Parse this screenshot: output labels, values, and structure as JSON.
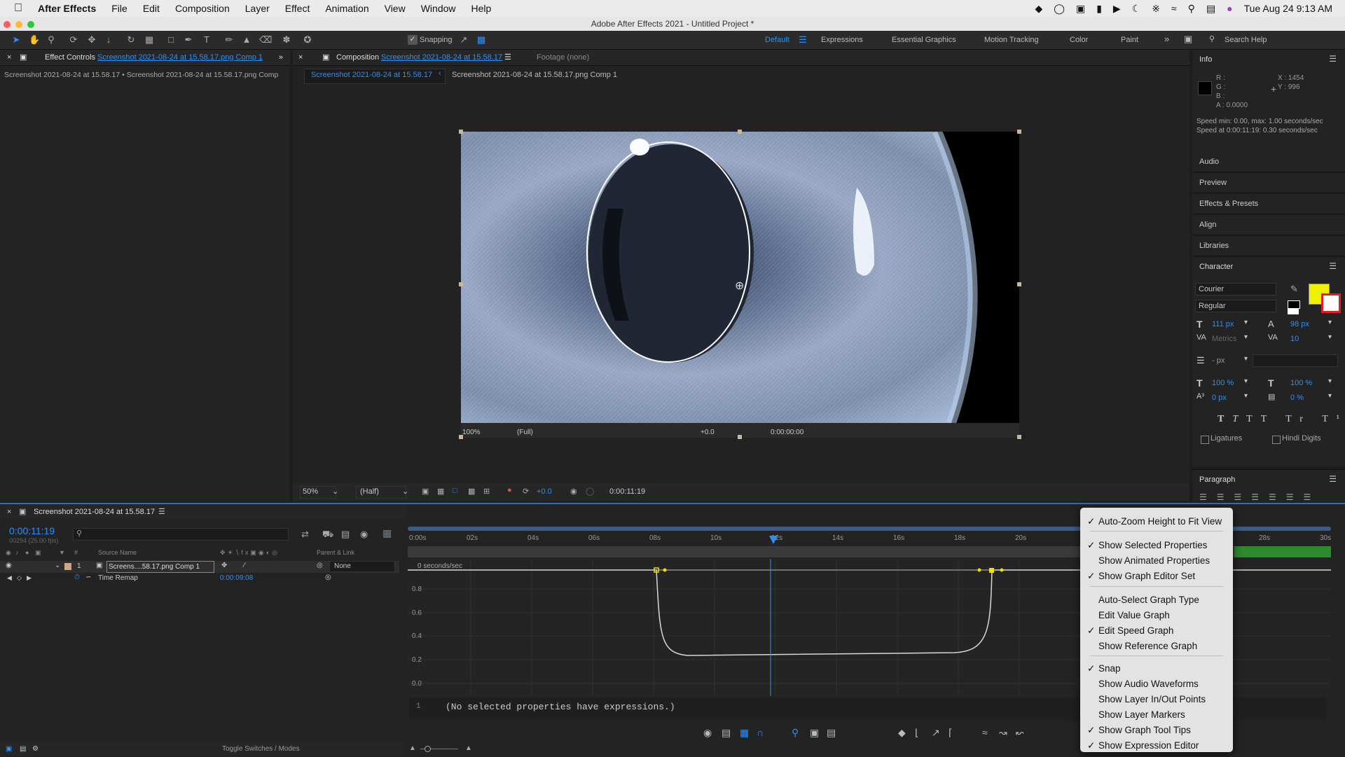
{
  "menubar": {
    "app": "After Effects",
    "items": [
      "File",
      "Edit",
      "Composition",
      "Layer",
      "Effect",
      "Animation",
      "View",
      "Window",
      "Help"
    ],
    "datetime": "Tue Aug 24  9:13 AM"
  },
  "window_title": "Adobe After Effects 2021 - Untitled Project *",
  "toolbar": {
    "snapping_label": "Snapping",
    "workspaces": [
      "Default",
      "Expressions",
      "Essential Graphics",
      "Motion Tracking",
      "Color",
      "Paint"
    ],
    "search_placeholder": "Search Help"
  },
  "effect_controls": {
    "label": "Effect Controls",
    "name": "Screenshot 2021-08-24 at 15.58.17.png Comp 1",
    "subtitle": "Screenshot 2021-08-24 at 15.58.17 • Screenshot 2021-08-24 at 15.58.17.png Comp"
  },
  "composition": {
    "label": "Composition",
    "name": "Screenshot 2021-08-24 at 15.58.17",
    "footage": "Footage (none)",
    "crumb_active": "Screenshot 2021-08-24 at 15.58.17",
    "crumb_other": "Screenshot 2021-08-24 at 15.58.17.png Comp 1",
    "zoom": "50%",
    "resolution": "(Half)",
    "exposure": "+0.0",
    "timecode": "0:00:11:19",
    "inner_zoom": "100%",
    "inner_res": "(Full)",
    "inner_exposure": "+0.0",
    "inner_timecode": "0:00:00:00"
  },
  "info": {
    "title": "Info",
    "r": "R :",
    "g": "G :",
    "b": "B :",
    "a": "A : 0.0000",
    "x": "X : 1454",
    "y": "Y : 996",
    "speed1": "Speed min: 0.00, max: 1.00 seconds/sec",
    "speed2": "Speed at 0:00:11:19: 0.30 seconds/sec"
  },
  "right_panels": [
    "Audio",
    "Preview",
    "Effects & Presets",
    "Align",
    "Libraries"
  ],
  "character": {
    "title": "Character",
    "font": "Courier",
    "style": "Regular",
    "size": "111 px",
    "leading": "98 px",
    "kerning": "Metrics",
    "tracking": "10",
    "stroke": "- px",
    "vscale": "100 %",
    "hscale": "100 %",
    "baseline": "0 px",
    "tsume": "0 %",
    "ligatures": "Ligatures",
    "hindi": "Hindi Digits",
    "fill_color": "#f0f000"
  },
  "paragraph": {
    "title": "Paragraph"
  },
  "timeline": {
    "tab": "Screenshot 2021-08-24 at 15.58.17",
    "timecode": "0:00:11:19",
    "frames": "00294 (25.00 fps)",
    "col_source": "Source Name",
    "col_parent": "Parent & Link",
    "layer_num": "1",
    "layer_name": "Screens....58.17.png Comp 1",
    "parent_value": "None",
    "prop_name": "Time Remap",
    "prop_value": "0:00:09:08",
    "toggle_label": "Toggle Switches / Modes",
    "ruler": [
      "0:00s",
      "02s",
      "04s",
      "06s",
      "08s",
      "10s",
      "12s",
      "14s",
      "16s",
      "18s",
      "20s",
      "28s",
      "30s"
    ],
    "graph_top_label": "0 seconds/sec",
    "y_labels": [
      "0.8",
      "0.6",
      "0.4",
      "0.2",
      "0.0"
    ],
    "expr_line": "1",
    "expr_text": "(No selected properties have expressions.)"
  },
  "context_menu": {
    "items": [
      {
        "label": "Auto-Zoom Height to Fit View",
        "checked": true
      },
      {
        "label": "Show Selected Properties",
        "checked": true
      },
      {
        "label": "Show Animated Properties",
        "checked": false
      },
      {
        "label": "Show Graph Editor Set",
        "checked": true
      },
      {
        "label": "Auto-Select Graph Type",
        "checked": false
      },
      {
        "label": "Edit Value Graph",
        "checked": false
      },
      {
        "label": "Edit Speed Graph",
        "checked": true
      },
      {
        "label": "Show Reference Graph",
        "checked": false
      },
      {
        "label": "Snap",
        "checked": true
      },
      {
        "label": "Show Audio Waveforms",
        "checked": false
      },
      {
        "label": "Show Layer In/Out Points",
        "checked": false
      },
      {
        "label": "Show Layer Markers",
        "checked": false
      },
      {
        "label": "Show Graph Tool Tips",
        "checked": true
      },
      {
        "label": "Show Expression Editor",
        "checked": true
      }
    ]
  },
  "colors": {
    "accent": "#2f8ff5",
    "keyframe": "#f0e000",
    "menu_bg": "#e3e3e3"
  }
}
